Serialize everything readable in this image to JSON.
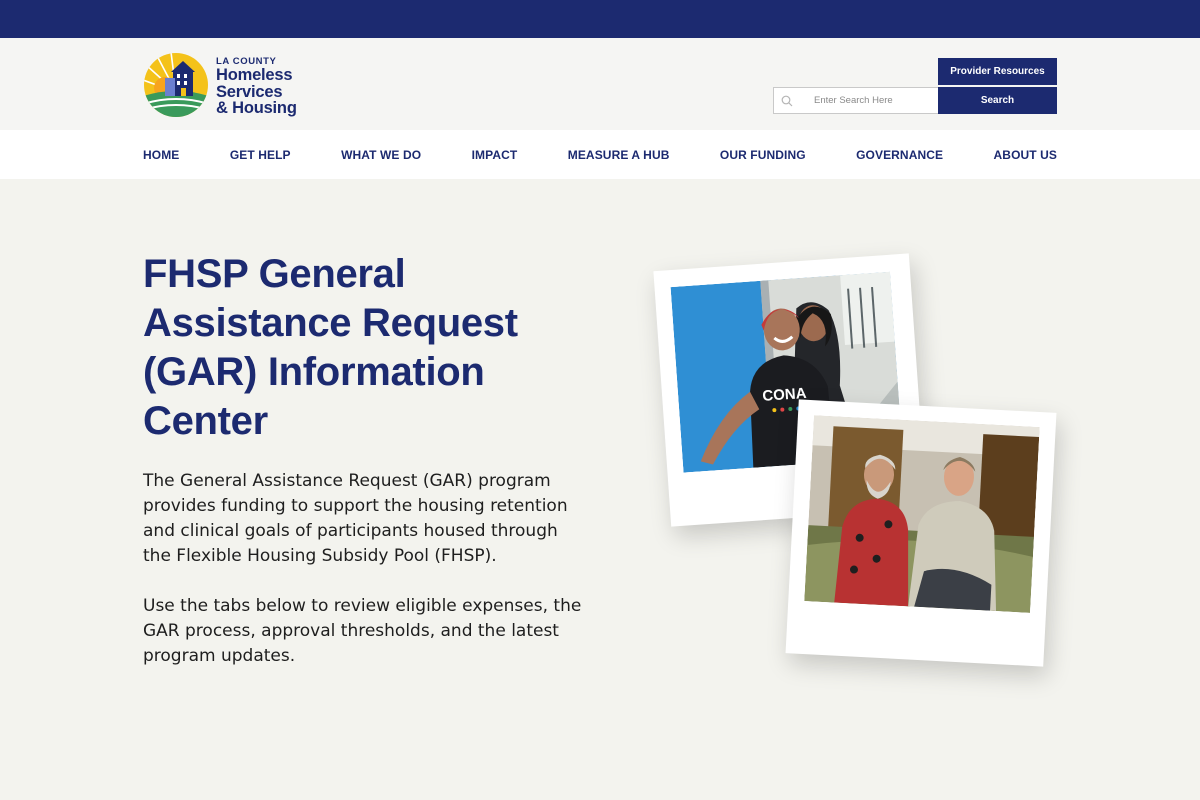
{
  "logo": {
    "line1": "LA COUNTY",
    "line2": "Homeless",
    "line3": "Services",
    "line4": "& Housing",
    "icon": "la-county-sun-house-logo-icon"
  },
  "header": {
    "provider_resources_label": "Provider Resources",
    "search_placeholder": "Enter Search Here",
    "search_value": "",
    "search_button_label": "Search"
  },
  "nav": {
    "items": [
      {
        "label": "HOME"
      },
      {
        "label": "GET HELP"
      },
      {
        "label": "WHAT WE DO"
      },
      {
        "label": "IMPACT"
      },
      {
        "label": "MEASURE A HUB"
      },
      {
        "label": "OUR FUNDING"
      },
      {
        "label": "GOVERNANCE"
      },
      {
        "label": "ABOUT US"
      }
    ]
  },
  "main": {
    "title": "FHSP General Assistance Request (GAR) Information Center",
    "paragraph1": "The General Assistance Request (GAR) program provides funding to support the housing retention and clinical goals of participants housed through the Flexible Housing Subsidy Pool (FHSP).",
    "paragraph2": "Use the tabs below to review eligible expenses, the GAR process, approval thresholds, and the latest program updates."
  },
  "photos": {
    "photo1_shirt_text": "CONA"
  },
  "colors": {
    "brand_navy": "#1c2a70",
    "page_background": "#f3f3ee",
    "header_background": "#f5f5f3",
    "logo_yellow": "#f4c21a",
    "logo_green": "#3a9a5b"
  }
}
